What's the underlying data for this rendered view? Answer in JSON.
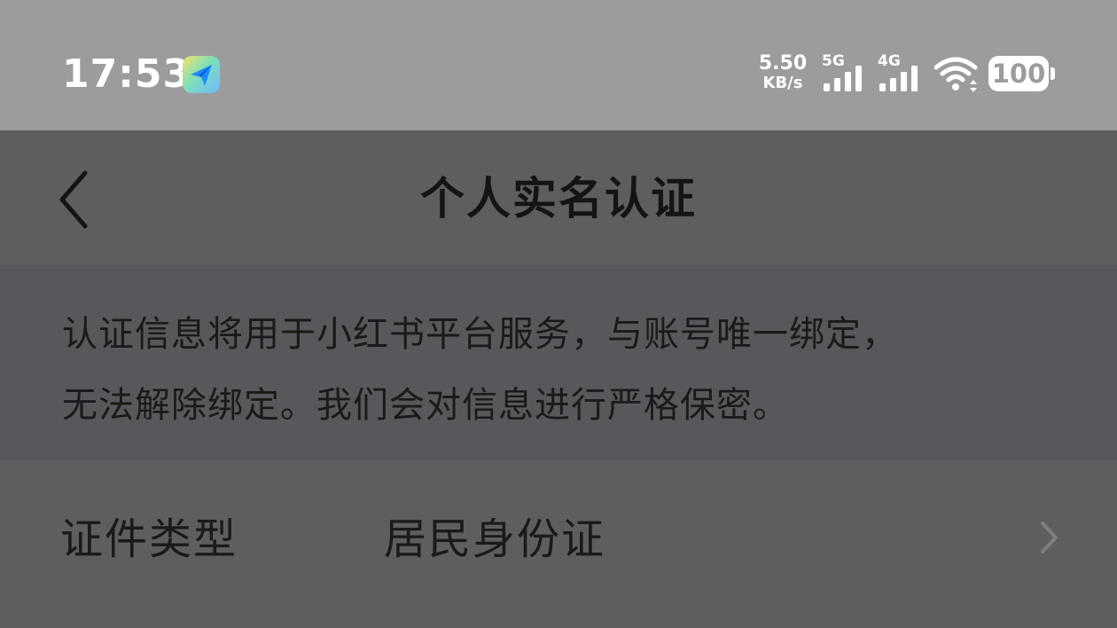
{
  "status_bar": {
    "time": "17:53",
    "app_icon": "paper-plane-icon",
    "net_speed_value": "5.50",
    "net_speed_unit": "KB/s",
    "signal_1_label": "5G",
    "signal_2_label": "4G",
    "wifi_icon": "wifi-icon",
    "battery_level": "100"
  },
  "header": {
    "back_icon": "chevron-left-icon",
    "title": "个人实名认证"
  },
  "notice": {
    "line1": "认证信息将用于小红书平台服务，与账号唯一绑定，",
    "line2": "无法解除绑定。我们会对信息进行严格保密。"
  },
  "form": {
    "id_type_label": "证件类型",
    "id_type_value": "居民身份证",
    "chevron_icon": "chevron-right-icon"
  },
  "colors": {
    "status_bar_bg": "#9c9c9d",
    "page_bg": "#5e5e5e",
    "notice_bg": "#56585b",
    "text": "#1a1a1a"
  }
}
